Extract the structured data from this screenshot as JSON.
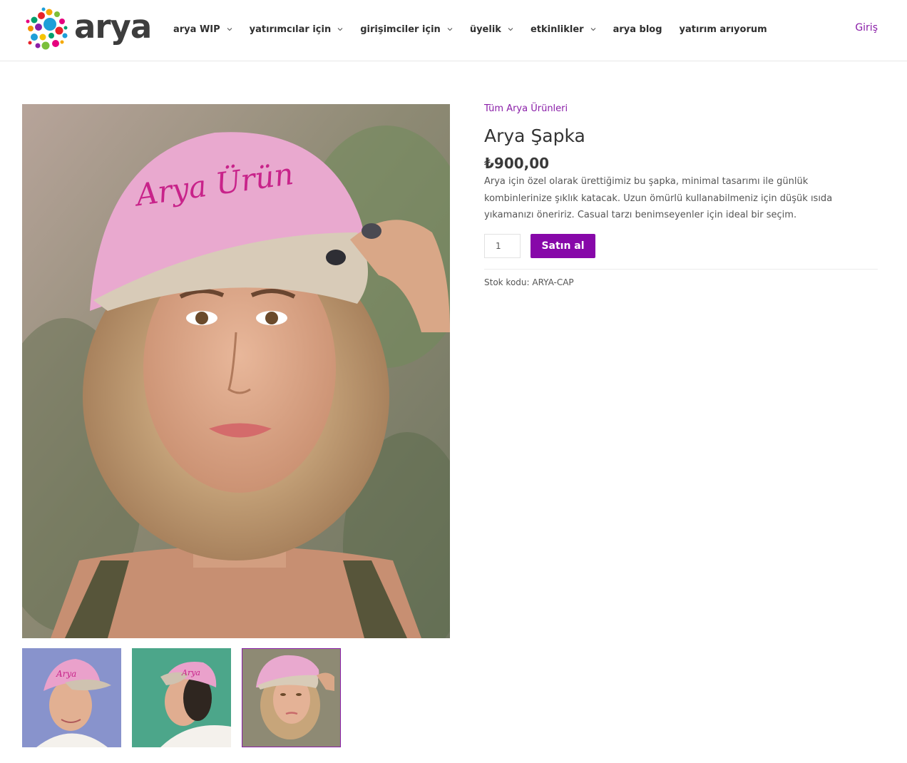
{
  "header": {
    "logo_text": "arya",
    "nav": [
      {
        "label": "arya WIP",
        "has_dropdown": true
      },
      {
        "label": "yatırımcılar için",
        "has_dropdown": true
      },
      {
        "label": "girişimciler için",
        "has_dropdown": true
      },
      {
        "label": "üyelik",
        "has_dropdown": true
      },
      {
        "label": "etkinlikler",
        "has_dropdown": true
      },
      {
        "label": "arya blog",
        "has_dropdown": false
      },
      {
        "label": "yatırım arıyorum",
        "has_dropdown": false
      }
    ],
    "login_label": "Giriş"
  },
  "gallery": {
    "main_image": "woman-wearing-pink-cap-photo",
    "thumbnails": [
      {
        "name": "pink-cap-front-photo",
        "active": false
      },
      {
        "name": "pink-cap-side-photo",
        "active": false
      },
      {
        "name": "pink-cap-portrait-photo",
        "active": true
      }
    ]
  },
  "product": {
    "category": "Tüm Arya Ürünleri",
    "title": "Arya Şapka",
    "price": "₺900,00",
    "description": "Arya için özel olarak ürettiğimiz bu şapka, minimal tasarımı ile günlük kombinlerinize şıklık katacak. Uzun ömürlü kullanabilmeniz için düşük ısıda yıkamanızı öneririz. Casual tarzı benimseyenler için ideal bir seçim.",
    "quantity": "1",
    "buy_label": "Satın al",
    "sku_label": "Stok kodu:",
    "sku_value": "ARYA-CAP"
  },
  "colors": {
    "accent": "#8a1ea8",
    "button": "#8708a9"
  }
}
